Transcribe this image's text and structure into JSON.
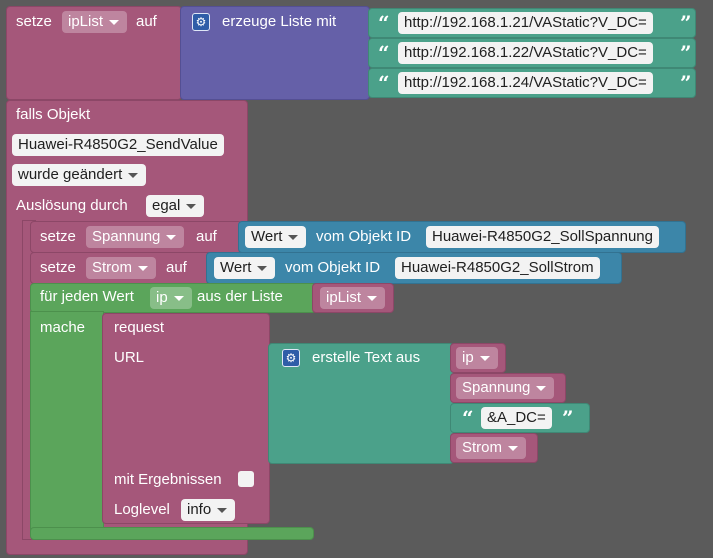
{
  "set_iplist": {
    "setze": "setze",
    "var": "ipList",
    "auf": "auf"
  },
  "create_list": {
    "gear_icon": "gear-icon",
    "label": "erzeuge Liste mit",
    "items": [
      "http://192.168.1.21/VAStatic?V_DC=",
      "http://192.168.1.22/VAStatic?V_DC=",
      "http://192.168.1.24/VAStatic?V_DC="
    ]
  },
  "trigger": {
    "falls_objekt": "falls Objekt",
    "object_id": "Huawei-R4850G2_SendValue",
    "changed": "wurde geändert",
    "ausloesung": "Auslösung durch",
    "egal": "egal"
  },
  "set_spannung": {
    "setze": "setze",
    "var": "Spannung",
    "auf": "auf",
    "wert": "Wert",
    "vom_objekt": "vom Objekt ID",
    "object_id": "Huawei-R4850G2_SollSpannung"
  },
  "set_strom": {
    "setze": "setze",
    "var": "Strom",
    "auf": "auf",
    "wert": "Wert",
    "vom_objekt": "vom Objekt ID",
    "object_id": "Huawei-R4850G2_SollStrom"
  },
  "for_each": {
    "label": "für jeden Wert",
    "var": "ip",
    "aus_liste": "aus der Liste",
    "list": "ipList",
    "mache": "mache"
  },
  "request": {
    "title": "request",
    "url": "URL",
    "mit_ergebnissen": "mit Ergebnissen",
    "loglevel": "Loglevel",
    "loglevel_value": "info"
  },
  "build_text": {
    "label": "erstelle Text aus",
    "items": [
      "ip",
      "Spannung",
      "&A_DC=",
      "Strom"
    ]
  }
}
